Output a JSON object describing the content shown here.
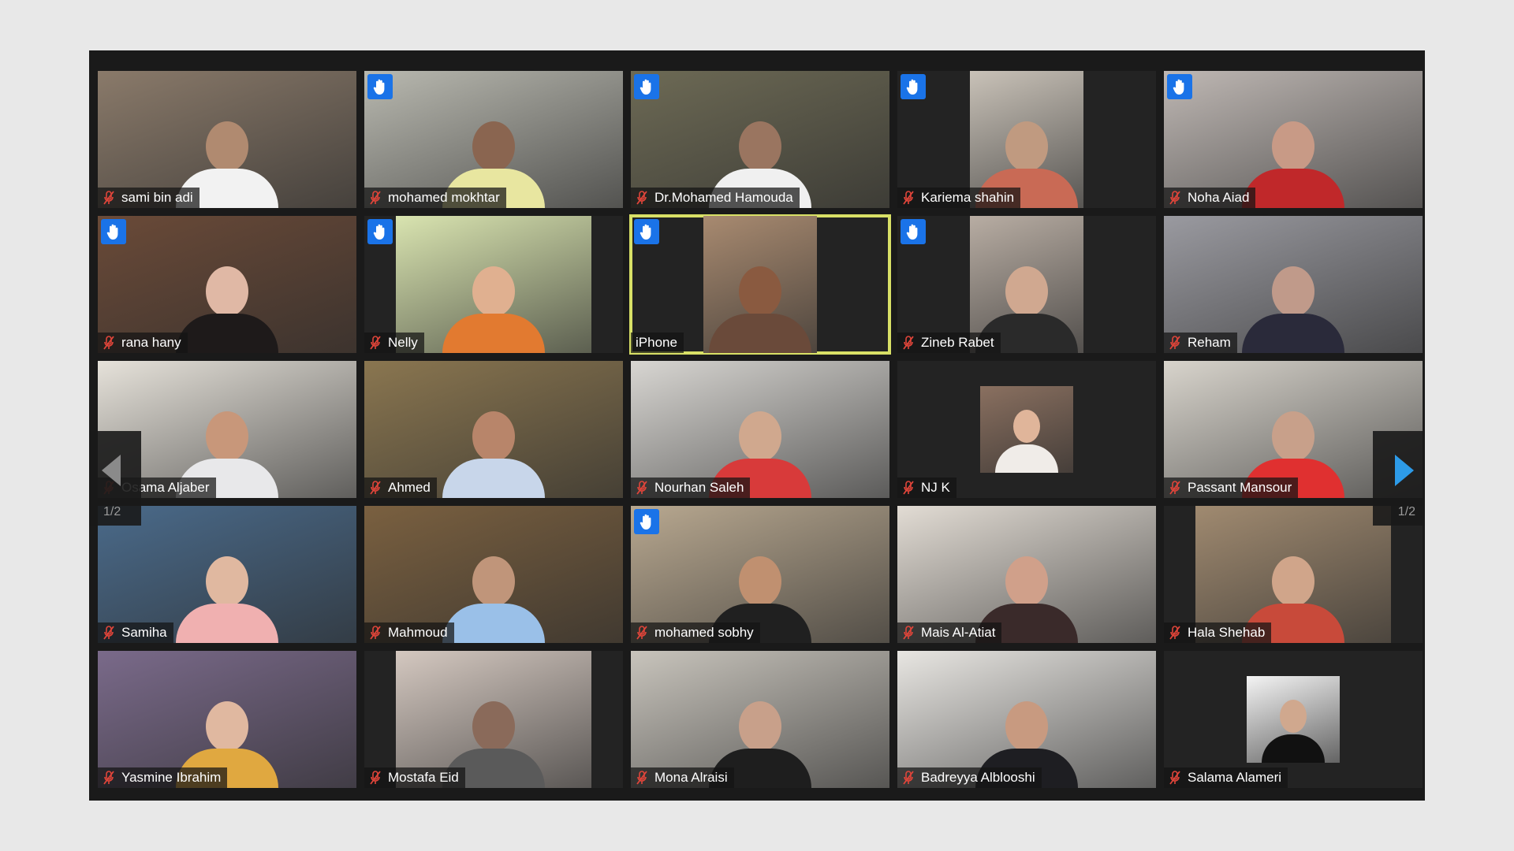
{
  "meeting": {
    "page_indicator": "1/2",
    "accent_color": "#1a73e8",
    "active_speaker_color": "#d8e066",
    "tiles": [
      {
        "name": "sami bin adi",
        "muted": true,
        "hand_raised": false,
        "bg": "#8a7a6a",
        "face": "#b08a70",
        "cloth": "#f2f2f2",
        "frame": "full"
      },
      {
        "name": "mohamed mokhtar",
        "muted": true,
        "hand_raised": true,
        "bg": "#b9b9b0",
        "face": "#8a6550",
        "cloth": "#e8e6a0",
        "frame": "full"
      },
      {
        "name": "Dr.Mohamed Hamouda",
        "muted": true,
        "hand_raised": true,
        "bg": "#6d6a55",
        "face": "#9a7560",
        "cloth": "#f0f0f0",
        "frame": "full"
      },
      {
        "name": "Kariema shahin",
        "muted": true,
        "hand_raised": true,
        "bg": "#c9c2b8",
        "face": "#c09a80",
        "cloth": "#c96a55",
        "frame": "pillarbox-wide"
      },
      {
        "name": "Noha Aiad",
        "muted": true,
        "hand_raised": true,
        "bg": "#bfb8b4",
        "face": "#c89a86",
        "cloth": "#c0282a",
        "frame": "full"
      },
      {
        "name": "rana hany",
        "muted": true,
        "hand_raised": true,
        "bg": "#6a4a38",
        "face": "#e0b8a5",
        "cloth": "#1e1a1a",
        "frame": "full"
      },
      {
        "name": "Nelly",
        "muted": true,
        "hand_raised": true,
        "bg": "#d9e4b0",
        "face": "#e0b090",
        "cloth": "#e27a30",
        "frame": "pillarbox"
      },
      {
        "name": "iPhone",
        "muted": false,
        "hand_raised": true,
        "bg": "#a88a70",
        "face": "#8a5a40",
        "cloth": "#6a4a3a",
        "frame": "pillarbox-wide",
        "active": true
      },
      {
        "name": "Zineb Rabet",
        "muted": true,
        "hand_raised": true,
        "bg": "#b8ada3",
        "face": "#d0a890",
        "cloth": "#2a2a2a",
        "frame": "pillarbox-wide"
      },
      {
        "name": "Reham",
        "muted": true,
        "hand_raised": false,
        "bg": "#9a9aa0",
        "face": "#c09a8a",
        "cloth": "#2a2a3a",
        "frame": "full"
      },
      {
        "name": "Osama Aljaber",
        "muted": true,
        "hand_raised": false,
        "bg": "#e6e2da",
        "face": "#c8977a",
        "cloth": "#e8e8ea",
        "frame": "full"
      },
      {
        "name": "Ahmed",
        "muted": true,
        "hand_raised": false,
        "bg": "#8a7650",
        "face": "#b8856a",
        "cloth": "#c8d6ea",
        "frame": "full"
      },
      {
        "name": "Nourhan Saleh",
        "muted": true,
        "hand_raised": false,
        "bg": "#d8d6d2",
        "face": "#d0a88e",
        "cloth": "#d83a3a",
        "frame": "full"
      },
      {
        "name": "NJ K",
        "muted": true,
        "hand_raised": false,
        "bg": "#8a7060",
        "face": "#e0b59a",
        "cloth": "#f0ece8",
        "frame": "avatar"
      },
      {
        "name": "Passant Mansour",
        "muted": true,
        "hand_raised": false,
        "bg": "#d8d4cc",
        "face": "#c8a08a",
        "cloth": "#e03030",
        "frame": "full"
      },
      {
        "name": "Samiha",
        "muted": true,
        "hand_raised": false,
        "bg": "#4a6a8a",
        "face": "#e0b8a0",
        "cloth": "#f0b0b0",
        "frame": "full"
      },
      {
        "name": "Mahmoud",
        "muted": true,
        "hand_raised": false,
        "bg": "#7a6040",
        "face": "#c0957a",
        "cloth": "#9ac0e8",
        "frame": "full"
      },
      {
        "name": "mohamed sobhy",
        "muted": true,
        "hand_raised": true,
        "bg": "#b8a890",
        "face": "#c09070",
        "cloth": "#202020",
        "frame": "full"
      },
      {
        "name": "Mais Al-Atiat",
        "muted": true,
        "hand_raised": false,
        "bg": "#e2dcd4",
        "face": "#d0a08a",
        "cloth": "#3a2a2a",
        "frame": "full"
      },
      {
        "name": "Hala Shehab",
        "muted": true,
        "hand_raised": false,
        "bg": "#a08a70",
        "face": "#d0a58a",
        "cloth": "#c84a3a",
        "frame": "pillarbox"
      },
      {
        "name": "Yasmine Ibrahim",
        "muted": true,
        "hand_raised": false,
        "bg": "#7a6a8a",
        "face": "#e0b8a0",
        "cloth": "#e0a840",
        "frame": "full"
      },
      {
        "name": "Mostafa Eid",
        "muted": true,
        "hand_raised": false,
        "bg": "#d4c8c0",
        "face": "#8a6a5a",
        "cloth": "#5a5a5a",
        "frame": "pillarbox"
      },
      {
        "name": "Mona Alraisi",
        "muted": true,
        "hand_raised": false,
        "bg": "#c8c4bc",
        "face": "#c8a08a",
        "cloth": "#1e1e1e",
        "frame": "full"
      },
      {
        "name": "Badreyya Alblooshi",
        "muted": true,
        "hand_raised": false,
        "bg": "#e8e6e2",
        "face": "#c89a80",
        "cloth": "#1e1e22",
        "frame": "full"
      },
      {
        "name": "Salama Alameri",
        "muted": true,
        "hand_raised": false,
        "bg": "#f4f4f4",
        "face": "#d0a88e",
        "cloth": "#111111",
        "frame": "avatar"
      }
    ]
  }
}
